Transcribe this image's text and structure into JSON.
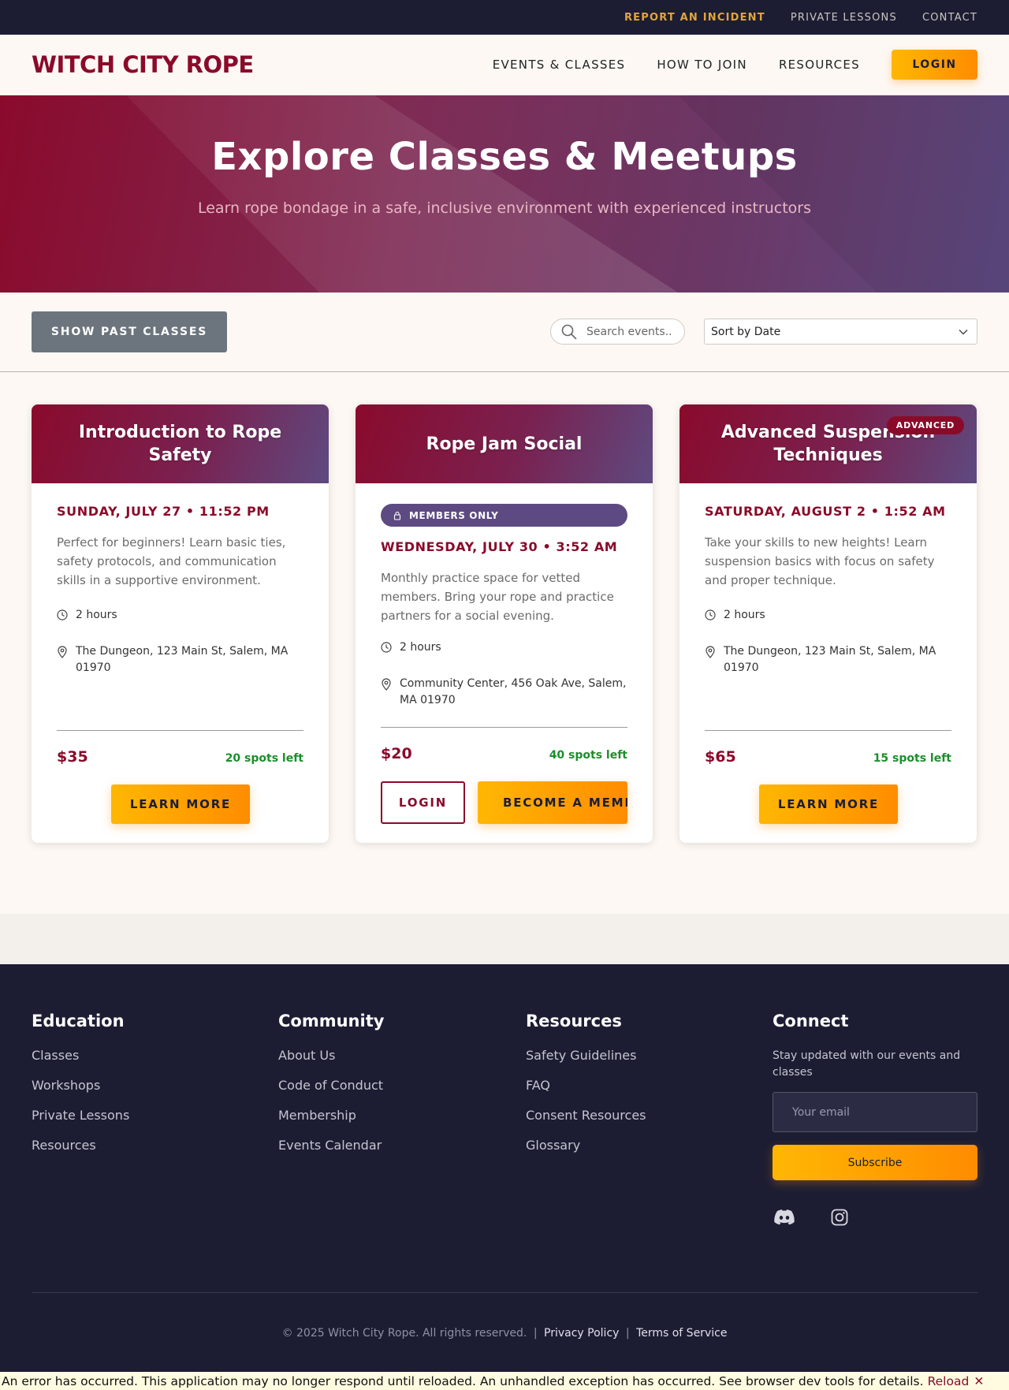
{
  "utility_nav": {
    "report": "REPORT AN INCIDENT",
    "private": "PRIVATE LESSONS",
    "contact": "CONTACT"
  },
  "header": {
    "logo": "WITCH CITY ROPE",
    "nav": [
      "EVENTS & CLASSES",
      "HOW TO JOIN",
      "RESOURCES"
    ],
    "login": "LOGIN"
  },
  "hero": {
    "title": "Explore Classes & Meetups",
    "subtitle": "Learn rope bondage in a safe, inclusive environment with experienced instructors"
  },
  "filters": {
    "past_button": "SHOW PAST CLASSES",
    "search_placeholder": "Search events...",
    "sort_value": "Sort by Date"
  },
  "events": [
    {
      "title": "Introduction to Rope Safety",
      "date": "SUNDAY, JULY 27 • 11:52 PM",
      "description": "Perfect for beginners! Learn basic ties, safety protocols, and communication skills in a supportive environment.",
      "duration": "2 hours",
      "location": "The Dungeon, 123 Main St, Salem, MA 01970",
      "price": "$35",
      "spots": "20 spots left",
      "button": "LEARN MORE"
    },
    {
      "title": "Rope Jam Social",
      "badge": "MEMBERS ONLY",
      "date": "WEDNESDAY, JULY 30 • 3:52 AM",
      "description": "Monthly practice space for vetted members. Bring your rope and practice partners for a social evening.",
      "duration": "2 hours",
      "location": "Community Center, 456 Oak Ave, Salem, MA 01970",
      "price": "$20",
      "spots": "40 spots left",
      "login_button": "LOGIN",
      "become_button": "BECOME A MEMBER"
    },
    {
      "title": "Advanced Suspension Techniques",
      "badge": "ADVANCED",
      "date": "SATURDAY, AUGUST 2 • 1:52 AM",
      "description": "Take your skills to new heights! Learn suspension basics with focus on safety and proper technique.",
      "duration": "2 hours",
      "location": "The Dungeon, 123 Main St, Salem, MA 01970",
      "price": "$65",
      "spots": "15 spots left",
      "button": "LEARN MORE"
    }
  ],
  "footer": {
    "education": {
      "heading": "Education",
      "links": [
        "Classes",
        "Workshops",
        "Private Lessons",
        "Resources"
      ]
    },
    "community": {
      "heading": "Community",
      "links": [
        "About Us",
        "Code of Conduct",
        "Membership",
        "Events Calendar"
      ]
    },
    "resources": {
      "heading": "Resources",
      "links": [
        "Safety Guidelines",
        "FAQ",
        "Consent Resources",
        "Glossary"
      ]
    },
    "connect": {
      "heading": "Connect",
      "text": "Stay updated with our events and classes",
      "email_placeholder": "Your email",
      "subscribe": "Subscribe",
      "socials": [
        "discord-icon",
        "instagram-icon"
      ]
    },
    "copyright": "© 2025 Witch City Rope. All rights reserved.",
    "privacy": "Privacy Policy",
    "terms": "Terms of Service"
  },
  "error_bar": {
    "message": "An error has occurred. This application may no longer respond until reloaded. An unhandled exception has occurred. See browser dev tools for details.",
    "reload": "Reload",
    "dismiss": "✕"
  },
  "colors": {
    "brand": "#8b0a2a",
    "accent": "#ffb703",
    "dark": "#1c1d33",
    "purple": "#5d4a82",
    "success": "#1a8f2a"
  }
}
